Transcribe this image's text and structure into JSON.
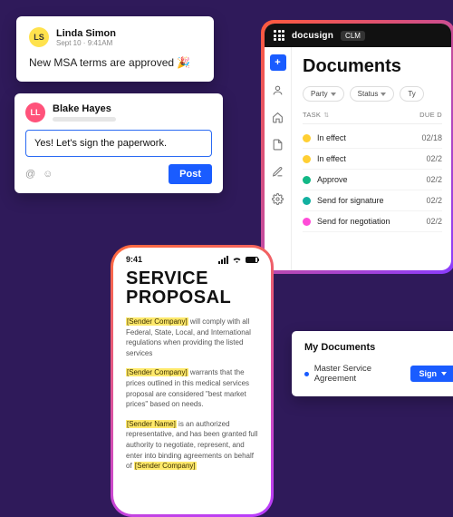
{
  "card_linda": {
    "avatar_initials": "LS",
    "name": "Linda Simon",
    "timestamp": "Sept 10 · 9:41AM",
    "message": "New MSA terms are approved 🎉"
  },
  "card_blake": {
    "avatar_initials": "LL",
    "name": "Blake Hayes",
    "compose_text": "Yes! Let's sign the paperwork.",
    "post_label": "Post"
  },
  "app": {
    "brand": "docusign",
    "product_badge": "CLM",
    "title": "Documents",
    "filters": {
      "party": "Party",
      "status": "Status",
      "type": "Ty"
    },
    "columns": {
      "task": "TASK",
      "due": "DUE D"
    },
    "rows": [
      {
        "status_color": "d-yel",
        "task": "In effect",
        "due": "02/18"
      },
      {
        "status_color": "d-yel",
        "task": "In effect",
        "due": "02/2"
      },
      {
        "status_color": "d-grn",
        "task": "Approve",
        "due": "02/2"
      },
      {
        "status_color": "d-teal",
        "task": "Send for signature",
        "due": "02/2"
      },
      {
        "status_color": "d-pnk",
        "task": "Send for negotiation",
        "due": "02/2"
      }
    ]
  },
  "phone": {
    "time": "9:41",
    "title_line1": "SERVICE",
    "title_line2": "PROPOSAL",
    "p1_tag": "[Sender Company]",
    "p1_rest": " will comply with all Federal, State, Local, and International regulations when providing the listed services",
    "p2_tag": "[Sender Company]",
    "p2_rest": " warrants that the prices outlined in this medical services proposal are considered \"best market prices\" based on needs.",
    "p3_tag": "[Sender Name]",
    "p3_rest": " is an authorized representative, and has been granted full authority to negotiate, represent, and enter into binding agreements on behalf of ",
    "p3_tag2": "[Sender Company]"
  },
  "mydocs": {
    "heading": "My Documents",
    "item": "Master Service Agreement",
    "action": "Sign"
  }
}
